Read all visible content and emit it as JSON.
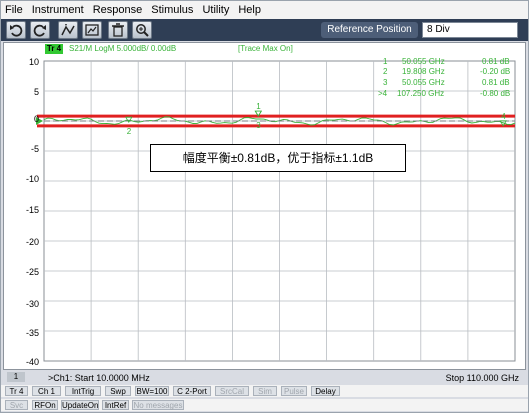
{
  "menu": [
    "File",
    "Instrument",
    "Response",
    "Stimulus",
    "Utility",
    "Help"
  ],
  "toolbar": {
    "buttons": [
      "undo-icon",
      "redo-icon",
      "marker-icon",
      "screenshot-icon",
      "trash-icon",
      "zoom-icon"
    ],
    "reference_position_label": "Reference Position",
    "reference_position_value": "8 Div"
  },
  "trace": {
    "tag": "Tr 4",
    "title": "S21/M LogM 5.000dB/ 0.00dB",
    "status": "[Trace Max On]",
    "color": "#38b238"
  },
  "markers": [
    {
      "id": "1",
      "freq": "50.055 GHz",
      "value": "0.81 dB"
    },
    {
      "id": "2",
      "freq": "19.808 GHz",
      "value": "-0.20 dB"
    },
    {
      "id": "3",
      "freq": "50.055 GHz",
      "value": "0.81 dB"
    },
    {
      "id": ">4",
      "freq": "107.250 GHz",
      "value": "-0.80 dB"
    }
  ],
  "y_ticks": [
    "10",
    "5",
    "0",
    "-5",
    "-10",
    "-15",
    "-20",
    "-25",
    "-30",
    "-35",
    "-40"
  ],
  "annotation": "幅度平衡±0.81dB，优于指标±1.1dB",
  "limit_lines": {
    "upper_db": 0.81,
    "lower_db": -0.81,
    "color": "#e02020"
  },
  "axis": {
    "channel_tag": "1",
    "start_label": ">Ch1: Start  10.0000 MHz",
    "stop_label": "Stop  110.000 GHz"
  },
  "status_row1": [
    {
      "label": "Tr 4",
      "dim": false
    },
    {
      "label": "Ch 1",
      "dim": false
    },
    {
      "label": "IntTrig",
      "dim": false
    },
    {
      "label": "Swp",
      "dim": false
    },
    {
      "label": "BW=100",
      "dim": false
    },
    {
      "label": "C  2-Port",
      "dim": false
    },
    {
      "label": "SrcCal",
      "dim": true
    },
    {
      "label": "Sim",
      "dim": true
    },
    {
      "label": "Pulse",
      "dim": true
    },
    {
      "label": "Delay",
      "dim": false
    }
  ],
  "status_row2": [
    {
      "label": "Svc",
      "dim": true
    },
    {
      "label": "RFOn",
      "dim": false
    },
    {
      "label": "UpdateOn",
      "dim": false
    },
    {
      "label": "IntRef",
      "dim": false
    },
    {
      "label": "No messages",
      "dim": true
    }
  ]
}
